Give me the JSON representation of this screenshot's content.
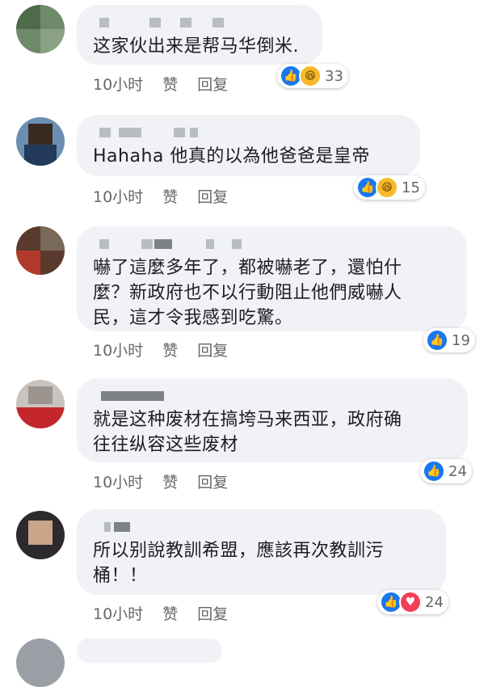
{
  "comments": [
    {
      "text": "这家伙出来是帮马华倒米.",
      "time": "10小时",
      "like_action": "赞",
      "reply_action": "回复",
      "reactions": [
        "like",
        "haha"
      ],
      "count": "33"
    },
    {
      "text": "Hahaha 他真的以為他爸爸是皇帝",
      "time": "10小时",
      "like_action": "赞",
      "reply_action": "回复",
      "reactions": [
        "like",
        "haha"
      ],
      "count": "15"
    },
    {
      "text": "嚇了這麼多年了，都被嚇老了，還怕什\n麼？新政府也不以行動阻止他們威嚇人\n民，這才令我感到吃驚。",
      "time": "10小时",
      "like_action": "赞",
      "reply_action": "回复",
      "reactions": [
        "like"
      ],
      "count": "19"
    },
    {
      "text": "就是这种废材在搞垮马来西亚，政府确\n往往纵容这些废材",
      "time": "10小时",
      "like_action": "赞",
      "reply_action": "回复",
      "reactions": [
        "like"
      ],
      "count": "24"
    },
    {
      "text": "所以别說教訓希盟，應該再次教訓污\n桶！！",
      "time": "10小时",
      "like_action": "赞",
      "reply_action": "回复",
      "reactions": [
        "like",
        "love"
      ],
      "count": "24"
    }
  ],
  "icons": {
    "like": "thumbs-up-icon",
    "haha": "laughing-face-icon",
    "love": "heart-icon"
  },
  "colors": {
    "like": "#1877f2",
    "haha": "#f7b928",
    "love": "#f33e58",
    "bubble": "#f0f2f5",
    "meta": "#65676b"
  }
}
